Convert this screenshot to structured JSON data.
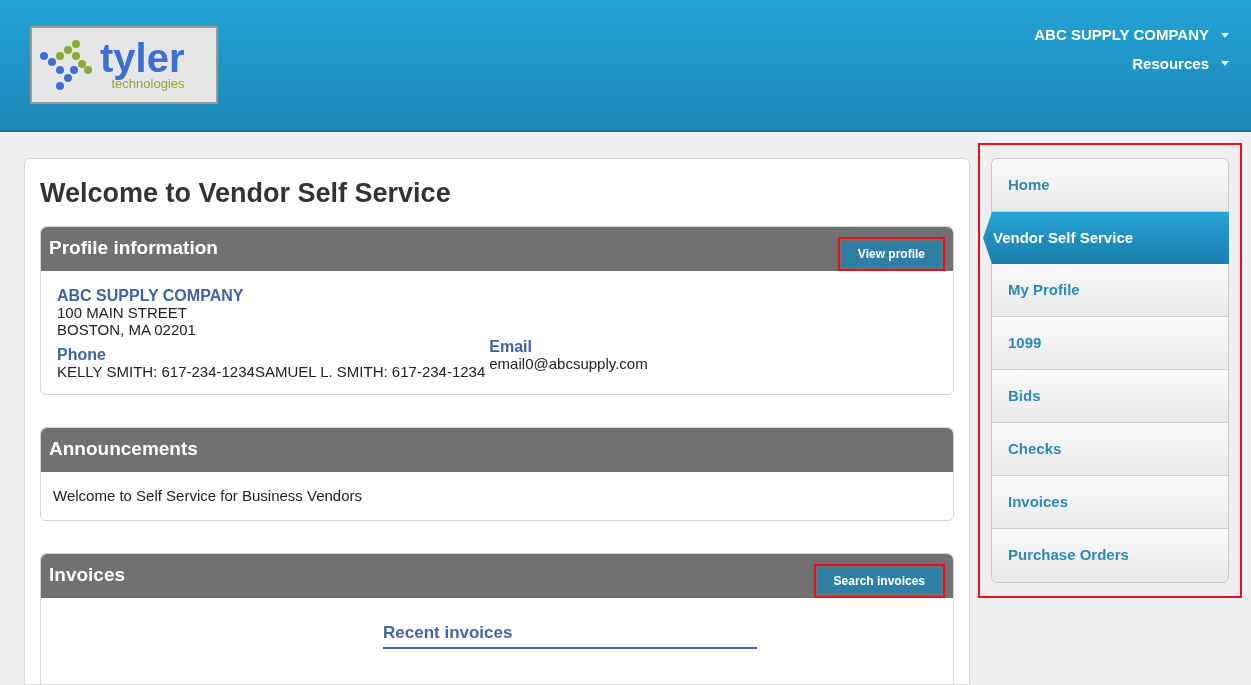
{
  "header": {
    "logo": {
      "word": "tyler",
      "subword": "technologies"
    },
    "menus": [
      {
        "label": "ABC SUPPLY COMPANY"
      },
      {
        "label": "Resources"
      }
    ]
  },
  "page_title": "Welcome to Vendor Self Service",
  "profile": {
    "title": "Profile information",
    "button": "View profile",
    "button_highlighted": true,
    "company": "ABC SUPPLY COMPANY",
    "address": [
      "100 MAIN STREET",
      "BOSTON, MA 02201"
    ],
    "phone_label": "Phone",
    "phone": "KELLY SMITH: 617-234-1234SAMUEL L. SMITH: 617-234-1234",
    "email_label": "Email",
    "email": "email0@abcsupply.com"
  },
  "announcements": {
    "title": "Announcements",
    "text": "Welcome to Self Service for Business Vendors"
  },
  "invoices": {
    "title": "Invoices",
    "button": "Search invoices",
    "button_highlighted": true,
    "subtitle": "Recent invoices"
  },
  "sidebar": {
    "highlighted": true,
    "items": [
      {
        "label": "Home",
        "selected": false
      },
      {
        "label": "Vendor Self Service",
        "selected": true
      },
      {
        "label": "My Profile",
        "selected": false
      },
      {
        "label": "1099",
        "selected": false
      },
      {
        "label": "Bids",
        "selected": false
      },
      {
        "label": "Checks",
        "selected": false
      },
      {
        "label": "Invoices",
        "selected": false
      },
      {
        "label": "Purchase Orders",
        "selected": false
      }
    ]
  }
}
